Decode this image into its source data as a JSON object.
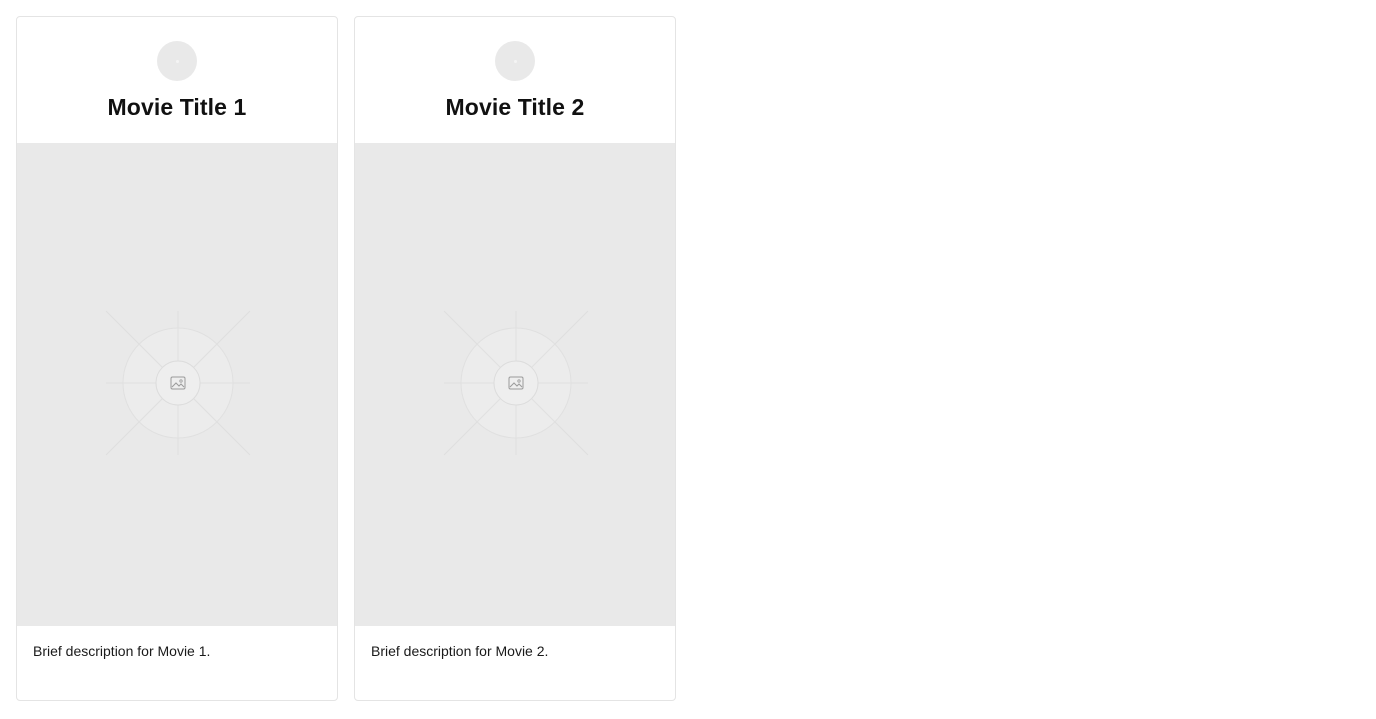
{
  "cards": [
    {
      "avatar_icon": "avatar-placeholder-icon",
      "title": "Movie Title 1",
      "image_icon": "image-placeholder-icon",
      "description": "Brief description for Movie 1."
    },
    {
      "avatar_icon": "avatar-placeholder-icon",
      "title": "Movie Title 2",
      "image_icon": "image-placeholder-icon",
      "description": "Brief description for Movie 2."
    }
  ],
  "colors": {
    "card_border": "#e4e4e4",
    "placeholder_bg": "#e9e9e9",
    "title_text": "#111111",
    "body_text": "#1a1a1a"
  }
}
